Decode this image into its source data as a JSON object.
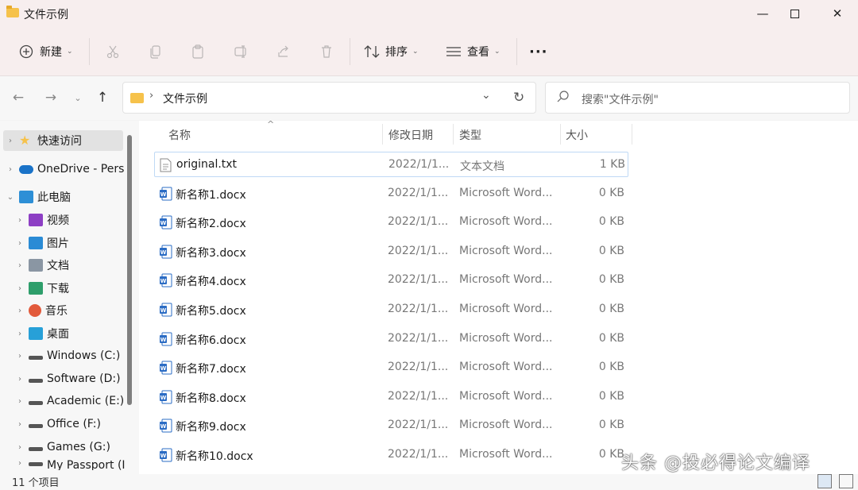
{
  "window": {
    "title": "文件示例"
  },
  "toolbar": {
    "new_label": "新建",
    "sort_label": "排序",
    "view_label": "查看",
    "more_label": "···"
  },
  "address": {
    "path": "文件示例",
    "search_placeholder": "搜索\"文件示例\""
  },
  "nav": {
    "items": [
      {
        "label": "快速访问",
        "icon": "star-icon",
        "color": "#f6c24b"
      },
      {
        "label": "OneDrive - Pers",
        "icon": "cloud-icon",
        "color": "#1a73c8"
      },
      {
        "label": "此电脑",
        "icon": "computer-icon",
        "color": "#2d8fd6"
      },
      {
        "label": "视频",
        "icon": "video-icon",
        "color": "#8d3fc4"
      },
      {
        "label": "图片",
        "icon": "picture-icon",
        "color": "#2a8bd5"
      },
      {
        "label": "文档",
        "icon": "document-icon",
        "color": "#8a96a3"
      },
      {
        "label": "下载",
        "icon": "download-icon",
        "color": "#2e9e6b"
      },
      {
        "label": "音乐",
        "icon": "music-icon",
        "color": "#e25a3b"
      },
      {
        "label": "桌面",
        "icon": "desktop-icon",
        "color": "#27a0d8"
      },
      {
        "label": "Windows (C:)",
        "icon": "drive-icon",
        "color": "#555555"
      },
      {
        "label": "Software (D:)",
        "icon": "drive-icon",
        "color": "#555555"
      },
      {
        "label": "Academic (E:)",
        "icon": "drive-icon",
        "color": "#555555"
      },
      {
        "label": "Office (F:)",
        "icon": "drive-icon",
        "color": "#555555"
      },
      {
        "label": "Games (G:)",
        "icon": "drive-icon",
        "color": "#555555"
      },
      {
        "label": "My Passport (I",
        "icon": "drive-icon",
        "color": "#555555"
      }
    ]
  },
  "columns": {
    "name": "名称",
    "date": "修改日期",
    "type": "类型",
    "size": "大小"
  },
  "files": [
    {
      "name": "original.txt",
      "date": "2022/1/1...",
      "type": "文本文档",
      "size": "1 KB",
      "icon": "text-file-icon"
    },
    {
      "name": "新名称1.docx",
      "date": "2022/1/1...",
      "type": "Microsoft Word...",
      "size": "0 KB",
      "icon": "word-file-icon"
    },
    {
      "name": "新名称2.docx",
      "date": "2022/1/1...",
      "type": "Microsoft Word...",
      "size": "0 KB",
      "icon": "word-file-icon"
    },
    {
      "name": "新名称3.docx",
      "date": "2022/1/1...",
      "type": "Microsoft Word...",
      "size": "0 KB",
      "icon": "word-file-icon"
    },
    {
      "name": "新名称4.docx",
      "date": "2022/1/1...",
      "type": "Microsoft Word...",
      "size": "0 KB",
      "icon": "word-file-icon"
    },
    {
      "name": "新名称5.docx",
      "date": "2022/1/1...",
      "type": "Microsoft Word...",
      "size": "0 KB",
      "icon": "word-file-icon"
    },
    {
      "name": "新名称6.docx",
      "date": "2022/1/1...",
      "type": "Microsoft Word...",
      "size": "0 KB",
      "icon": "word-file-icon"
    },
    {
      "name": "新名称7.docx",
      "date": "2022/1/1...",
      "type": "Microsoft Word...",
      "size": "0 KB",
      "icon": "word-file-icon"
    },
    {
      "name": "新名称8.docx",
      "date": "2022/1/1...",
      "type": "Microsoft Word...",
      "size": "0 KB",
      "icon": "word-file-icon"
    },
    {
      "name": "新名称9.docx",
      "date": "2022/1/1...",
      "type": "Microsoft Word...",
      "size": "0 KB",
      "icon": "word-file-icon"
    },
    {
      "name": "新名称10.docx",
      "date": "2022/1/1...",
      "type": "Microsoft Word...",
      "size": "0 KB",
      "icon": "word-file-icon"
    }
  ],
  "status": {
    "count": "11 个项目"
  },
  "watermark": {
    "text": "头条 @投必得论文编译"
  }
}
